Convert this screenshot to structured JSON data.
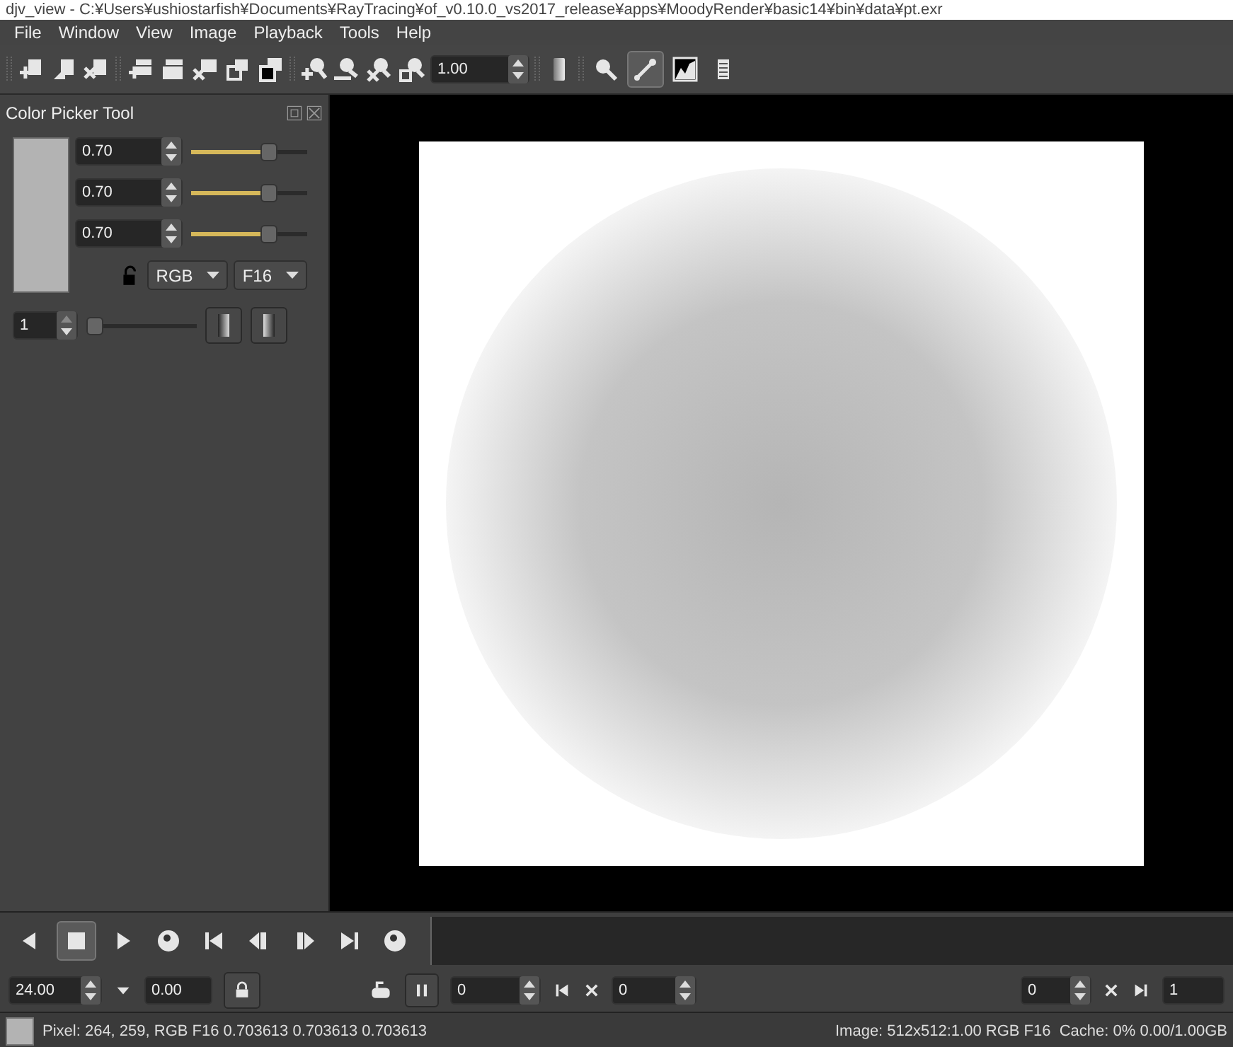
{
  "window": {
    "title": "djv_view - C:¥Users¥ushiostarfish¥Documents¥RayTracing¥of_v0.10.0_vs2017_release¥apps¥MoodyRender¥basic14¥bin¥data¥pt.exr"
  },
  "menu": [
    "File",
    "Window",
    "View",
    "Image",
    "Playback",
    "Tools",
    "Help"
  ],
  "toolbar": {
    "zoom": "1.00",
    "view_tools": [
      {
        "selected": false
      },
      {
        "selected": true
      },
      {
        "selected": false
      },
      {
        "selected": false
      }
    ]
  },
  "color_picker": {
    "title": "Color Picker Tool",
    "channels": [
      {
        "value": "0.70",
        "level": 0.7
      },
      {
        "value": "0.70",
        "level": 0.7
      },
      {
        "value": "0.70",
        "level": 0.7
      }
    ],
    "format": "RGB",
    "type": "F16",
    "size": {
      "value": "1",
      "level": 0
    }
  },
  "playback": {
    "buttons": [
      {
        "selected": false
      },
      {
        "selected": true
      },
      {
        "selected": false
      },
      {
        "selected": false
      },
      {
        "selected": false
      },
      {
        "selected": false
      },
      {
        "selected": false
      },
      {
        "selected": false
      },
      {
        "selected": false
      }
    ],
    "speed": "24.00",
    "actual_speed": "0.00",
    "in_frame": "0",
    "out_frame": "0",
    "current_frame": "0",
    "end_frame": "1"
  },
  "status": {
    "pixel": "Pixel: 264, 259, RGB F16 0.703613 0.703613 0.703613",
    "image": "Image: 512x512:1.00 RGB F16  Cache: 0% 0.00/1.00GB"
  }
}
